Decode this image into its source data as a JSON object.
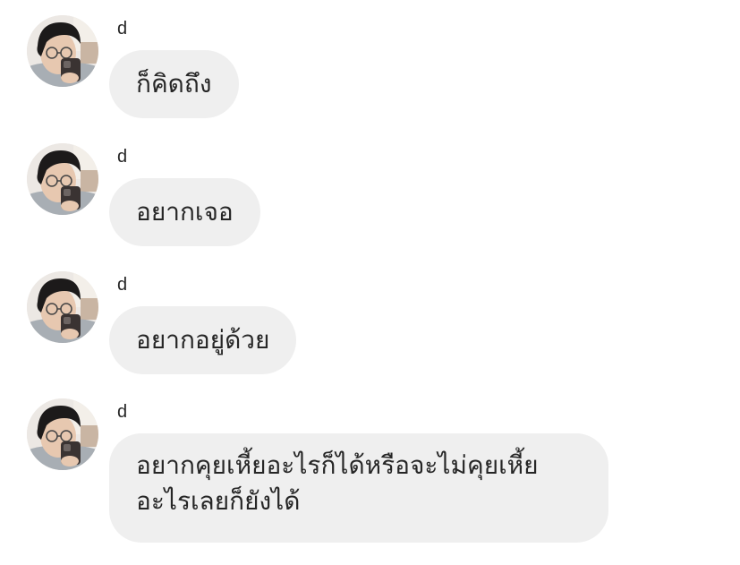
{
  "messages": [
    {
      "sender": "d",
      "text": "ก็คิดถึง",
      "avatar": "profile-photo"
    },
    {
      "sender": "d",
      "text": "อยากเจอ",
      "avatar": "profile-photo"
    },
    {
      "sender": "d",
      "text": "อยากอยู่ด้วย",
      "avatar": "profile-photo"
    },
    {
      "sender": "d",
      "text_line1": "อยากคุยเหี้ยอะไรก็ได้หรือจะไม่คุยเหี้ย",
      "text_line2": "อะไรเลยก็ยังได้",
      "avatar": "profile-photo"
    }
  ],
  "colors": {
    "bubble": "#efefef",
    "text": "#262626",
    "background": "#ffffff"
  }
}
